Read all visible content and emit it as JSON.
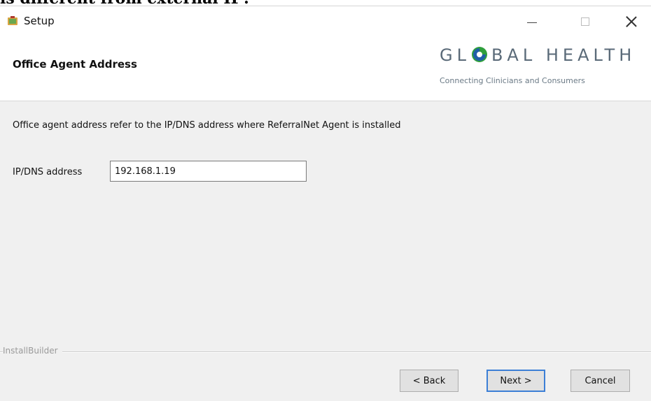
{
  "page_top_text": "is different from external IP?",
  "window": {
    "title": "Setup",
    "icons": {
      "app": "setup-app-icon",
      "minimize": "minimize-icon",
      "maximize": "maximize-icon",
      "close": "close-icon"
    }
  },
  "header": {
    "title": "Office Agent Address",
    "logo": {
      "word_left": "GL",
      "word_right": "BAL HEALTH",
      "tagline": "Connecting Clinicians and Consumers",
      "mark_icon": "globe-o-icon",
      "colors": {
        "text": "#5a6a78",
        "mark_green": "#2f9e3c",
        "mark_blue": "#1f5fa8"
      }
    }
  },
  "body": {
    "description": "Office agent address refer to the IP/DNS address where ReferralNet Agent is installed",
    "ip_field": {
      "label": "IP/DNS address",
      "value": "192.168.1.19"
    }
  },
  "footer": {
    "builder_label": "InstallBuilder",
    "buttons": {
      "back": "< Back",
      "next": "Next >",
      "cancel": "Cancel"
    }
  },
  "colors": {
    "window_bg": "#f0f0f0",
    "default_button_border": "#3c7fd6"
  }
}
